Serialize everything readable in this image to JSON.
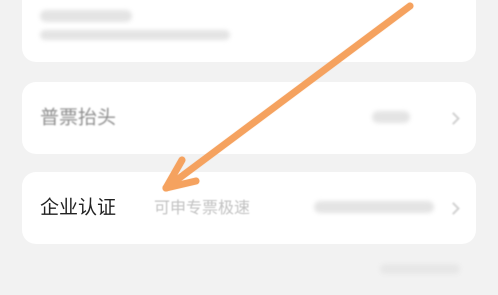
{
  "rows": {
    "invoice_title": {
      "label": "普票抬头"
    },
    "enterprise_cert": {
      "label": "企业认证",
      "subtitle": "可申专票极速"
    }
  },
  "icons": {
    "annotation_arrow": "arrow-icon",
    "row_chevron": "chevron-right-icon"
  },
  "colors": {
    "background": "#f2f2f2",
    "card": "#ffffff",
    "text_primary": "#222222",
    "text_muted": "#8e8e8e",
    "text_hint": "#c2c2c2",
    "arrow": "#f5a25f"
  }
}
